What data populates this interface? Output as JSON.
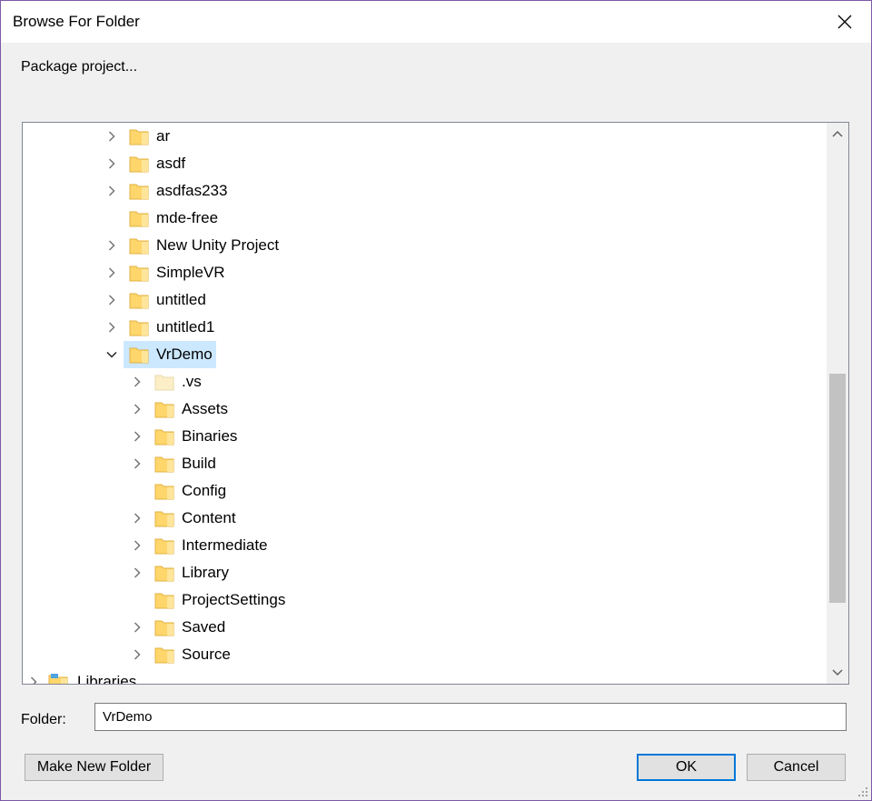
{
  "window": {
    "title": "Browse For Folder",
    "instruction": "Package project..."
  },
  "tree": {
    "items": [
      {
        "label": "ar",
        "level": 0,
        "expander": "collapsed"
      },
      {
        "label": "asdf",
        "level": 0,
        "expander": "collapsed"
      },
      {
        "label": "asdfas233",
        "level": 0,
        "expander": "collapsed"
      },
      {
        "label": "mde-free",
        "level": 0,
        "expander": "none"
      },
      {
        "label": "New Unity Project",
        "level": 0,
        "expander": "collapsed"
      },
      {
        "label": "SimpleVR",
        "level": 0,
        "expander": "collapsed"
      },
      {
        "label": "untitled",
        "level": 0,
        "expander": "collapsed"
      },
      {
        "label": "untitled1",
        "level": 0,
        "expander": "collapsed"
      },
      {
        "label": "VrDemo",
        "level": 0,
        "expander": "expanded",
        "selected": true
      },
      {
        "label": ".vs",
        "level": 1,
        "expander": "collapsed",
        "hidden_folder": true
      },
      {
        "label": "Assets",
        "level": 1,
        "expander": "collapsed"
      },
      {
        "label": "Binaries",
        "level": 1,
        "expander": "collapsed"
      },
      {
        "label": "Build",
        "level": 1,
        "expander": "collapsed"
      },
      {
        "label": "Config",
        "level": 1,
        "expander": "none"
      },
      {
        "label": "Content",
        "level": 1,
        "expander": "collapsed"
      },
      {
        "label": "Intermediate",
        "level": 1,
        "expander": "collapsed"
      },
      {
        "label": "Library",
        "level": 1,
        "expander": "collapsed"
      },
      {
        "label": "ProjectSettings",
        "level": 1,
        "expander": "none"
      },
      {
        "label": "Saved",
        "level": 1,
        "expander": "collapsed"
      },
      {
        "label": "Source",
        "level": 1,
        "expander": "collapsed"
      },
      {
        "label": "Libraries",
        "level": -1,
        "expander": "collapsed",
        "icon": "libraries-icon"
      }
    ]
  },
  "folder_field": {
    "label": "Folder:",
    "value": "VrDemo"
  },
  "buttons": {
    "make_new_folder": "Make New Folder",
    "ok": "OK",
    "cancel": "Cancel"
  },
  "colors": {
    "selection": "#cce8ff",
    "focus_border": "#0078d7",
    "folder_yellow": "#ffd66b",
    "window_border": "#7b5aa6"
  }
}
